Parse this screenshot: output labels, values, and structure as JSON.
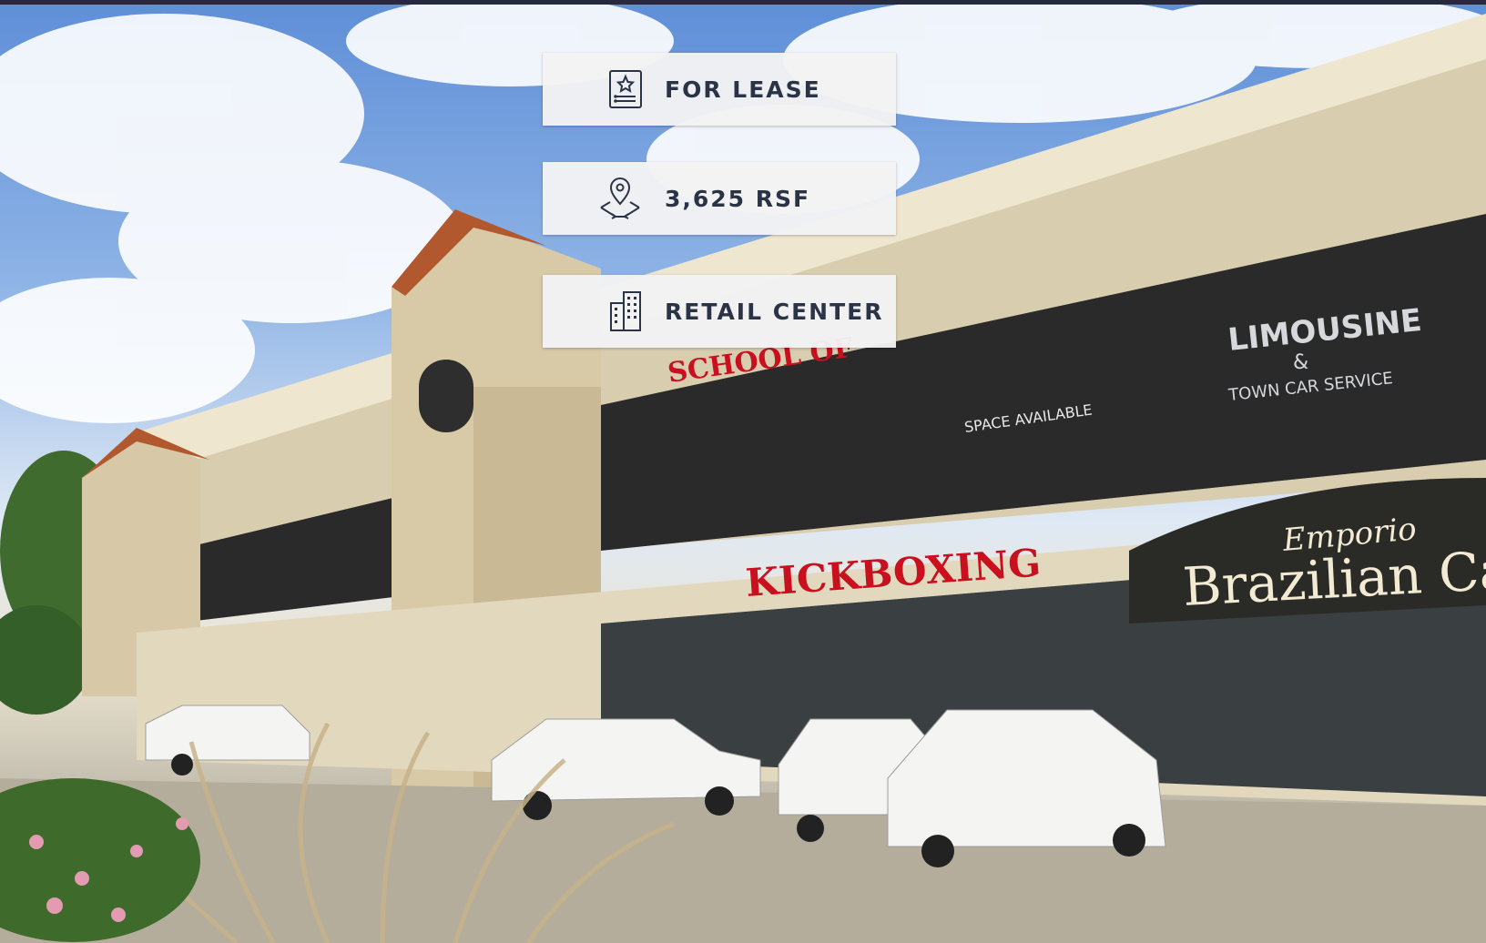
{
  "badges": [
    {
      "label": "FOR LEASE",
      "icon": "certificate-document-icon"
    },
    {
      "label": "3,625 RSF",
      "icon": "map-pin-area-icon"
    },
    {
      "label": "RETAIL CENTER",
      "icon": "office-building-icon"
    }
  ],
  "photo": {
    "signs": {
      "school": "SCHOOL OF",
      "kickboxing": "KICKBOXING",
      "limousine": "LIMOUSINE",
      "limousine_sub": "&",
      "town_car": "TOWN CAR SERVICE",
      "space_available": "SPACE AVAILABLE",
      "awning_script": "Emporio",
      "awning_main": "Brazilian Ca"
    }
  },
  "colors": {
    "top_bar": "#262a3e",
    "badge_bg": "#f2f3f4",
    "badge_text": "#2b3446",
    "sign_red": "#c8101e"
  }
}
